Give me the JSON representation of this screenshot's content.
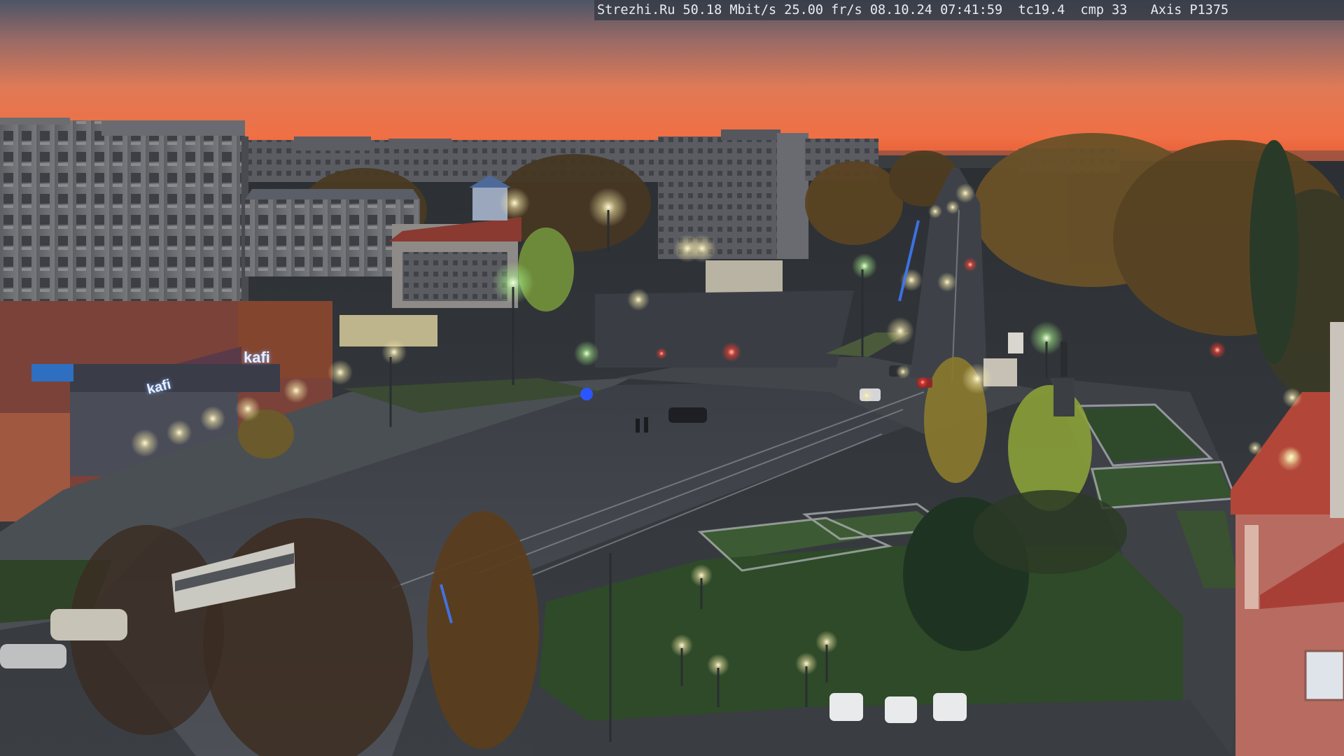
{
  "camera": {
    "overlay_text": "Strezhi.Ru 50.18 Mbit/s 25.00 fr/s 08.10.24 07:41:59  tc19.4  cmp 33   Axis P1375"
  },
  "signage": {
    "shop_sign": "kafi",
    "shop_sign_lower": "kafi"
  },
  "scene": {
    "time_of_day": "dawn",
    "colors": {
      "sky_top": "#4a5668",
      "sky_glow": "#f07a4a",
      "horizon": "#e9633f",
      "street_light": "#f3e6b0",
      "neon_blue": "#3f7cff"
    }
  }
}
